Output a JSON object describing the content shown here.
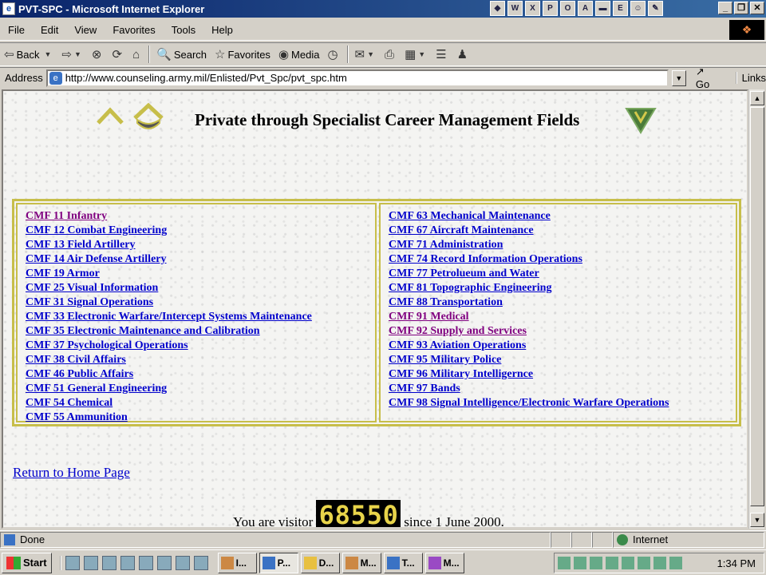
{
  "window": {
    "title": "PVT-SPC - Microsoft Internet Explorer"
  },
  "menu": [
    "File",
    "Edit",
    "View",
    "Favorites",
    "Tools",
    "Help"
  ],
  "toolbar": {
    "back": "Back",
    "search": "Search",
    "favorites": "Favorites",
    "media": "Media"
  },
  "address": {
    "label": "Address",
    "url": "http://www.counseling.army.mil/Enlisted/Pvt_Spc/pvt_spc.htm",
    "go": "Go",
    "links": "Links"
  },
  "page": {
    "title": "Private through Specialist Career Management Fields",
    "left_column": [
      {
        "text": "CMF 11 Infantry",
        "visited": true
      },
      {
        "text": "CMF 12 Combat Engineering",
        "visited": false
      },
      {
        "text": "CMF 13 Field Artillery",
        "visited": false
      },
      {
        "text": "CMF 14 Air Defense Artillery",
        "visited": false
      },
      {
        "text": "CMF 19 Armor",
        "visited": false
      },
      {
        "text": "CMF 25 Visual Information",
        "visited": false
      },
      {
        "text": "CMF 31 Signal Operations",
        "visited": false
      },
      {
        "text": "CMF 33 Electronic Warfare/Intercept Systems Maintenance",
        "visited": false
      },
      {
        "text": "CMF 35 Electronic Maintenance and Calibration",
        "visited": false
      },
      {
        "text": "CMF 37 Psychological  Operations",
        "visited": false
      },
      {
        "text": "CMF 38 Civil Affairs",
        "visited": false
      },
      {
        "text": "CMF 46 Public Affairs",
        "visited": false
      },
      {
        "text": "CMF 51 General Engineering",
        "visited": false
      },
      {
        "text": "CMF 54 Chemical",
        "visited": false
      },
      {
        "text": "CMF 55 Ammunition",
        "visited": false
      }
    ],
    "right_column": [
      {
        "text": "CMF 63 Mechanical Maintenance",
        "visited": false
      },
      {
        "text": "CMF 67 Aircraft Maintenance",
        "visited": false
      },
      {
        "text": "CMF 71 Administration",
        "visited": false
      },
      {
        "text": "CMF 74 Record Information Operations",
        "visited": false
      },
      {
        "text": "CMF 77 Petrolueum and Water",
        "visited": false
      },
      {
        "text": "CMF 81 Topographic Engineering",
        "visited": false
      },
      {
        "text": "CMF 88 Transportation",
        "visited": false
      },
      {
        "text": "CMF 91 Medical",
        "visited": true
      },
      {
        "text": "CMF 92 Supply and Services",
        "visited": true
      },
      {
        "text": "CMF 93 Aviation Operations",
        "visited": false
      },
      {
        "text": "CMF 95 Military Police",
        "visited": false
      },
      {
        "text": "CMF 96 Military Intelligernce",
        "visited": false
      },
      {
        "text": "CMF 97 Bands",
        "visited": false
      },
      {
        "text": "CMF 98 Signal Intelligence/Electronic Warfare Operations",
        "visited": false
      }
    ],
    "home_link": "Return to Home Page",
    "visitor_prefix": "You are visitor",
    "visitor_count": "68550",
    "visitor_suffix": "since 1 June 2000."
  },
  "status": {
    "text": "Done",
    "zone": "Internet"
  },
  "taskbar": {
    "start": "Start",
    "tasks": [
      "I...",
      "P...",
      "D...",
      "M...",
      "T...",
      "M..."
    ],
    "clock": "1:34 PM"
  },
  "colors": {
    "link": "#0000cc",
    "visited": "#800080",
    "table_border": "#c7be4a",
    "title_bar": "#0a246a"
  }
}
